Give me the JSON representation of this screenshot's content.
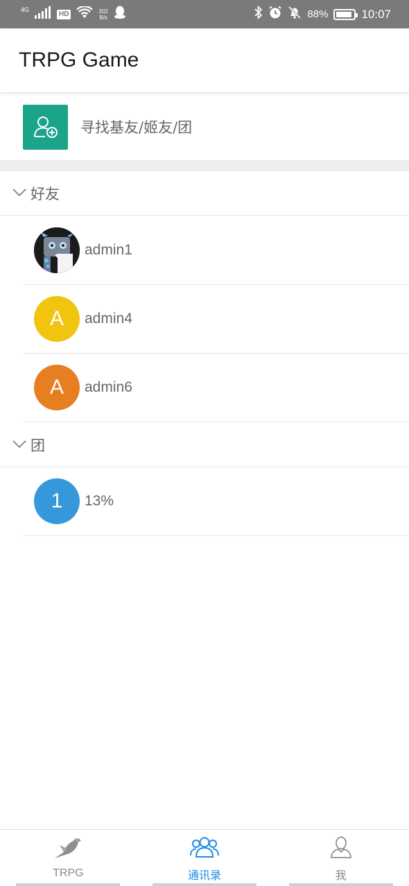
{
  "status_bar": {
    "network": "4G",
    "hd": "HD",
    "speed_value": "202",
    "speed_unit": "B/s",
    "battery": "88%",
    "battery_level": 0.88,
    "time": "10:07"
  },
  "header": {
    "title": "TRPG Game"
  },
  "find": {
    "label": "寻找基友/姬友/团",
    "color": "#1aa589"
  },
  "sections": [
    {
      "title": "好友",
      "items": [
        {
          "name": "admin1",
          "avatar_letter": "",
          "avatar_color": "#222222",
          "avatar_type": "image"
        },
        {
          "name": "admin4",
          "avatar_letter": "A",
          "avatar_color": "#f1c40f"
        },
        {
          "name": "admin6",
          "avatar_letter": "A",
          "avatar_color": "#e67e22"
        }
      ]
    },
    {
      "title": "团",
      "items": [
        {
          "name": "13%",
          "avatar_letter": "1",
          "avatar_color": "#3498db"
        }
      ]
    }
  ],
  "bottom_nav": {
    "tabs": [
      {
        "label": "TRPG",
        "icon": "pigeon-icon"
      },
      {
        "label": "通讯录",
        "icon": "contacts-icon",
        "active": true
      },
      {
        "label": "我",
        "icon": "user-icon"
      }
    ],
    "active_color": "#1e88e5"
  }
}
